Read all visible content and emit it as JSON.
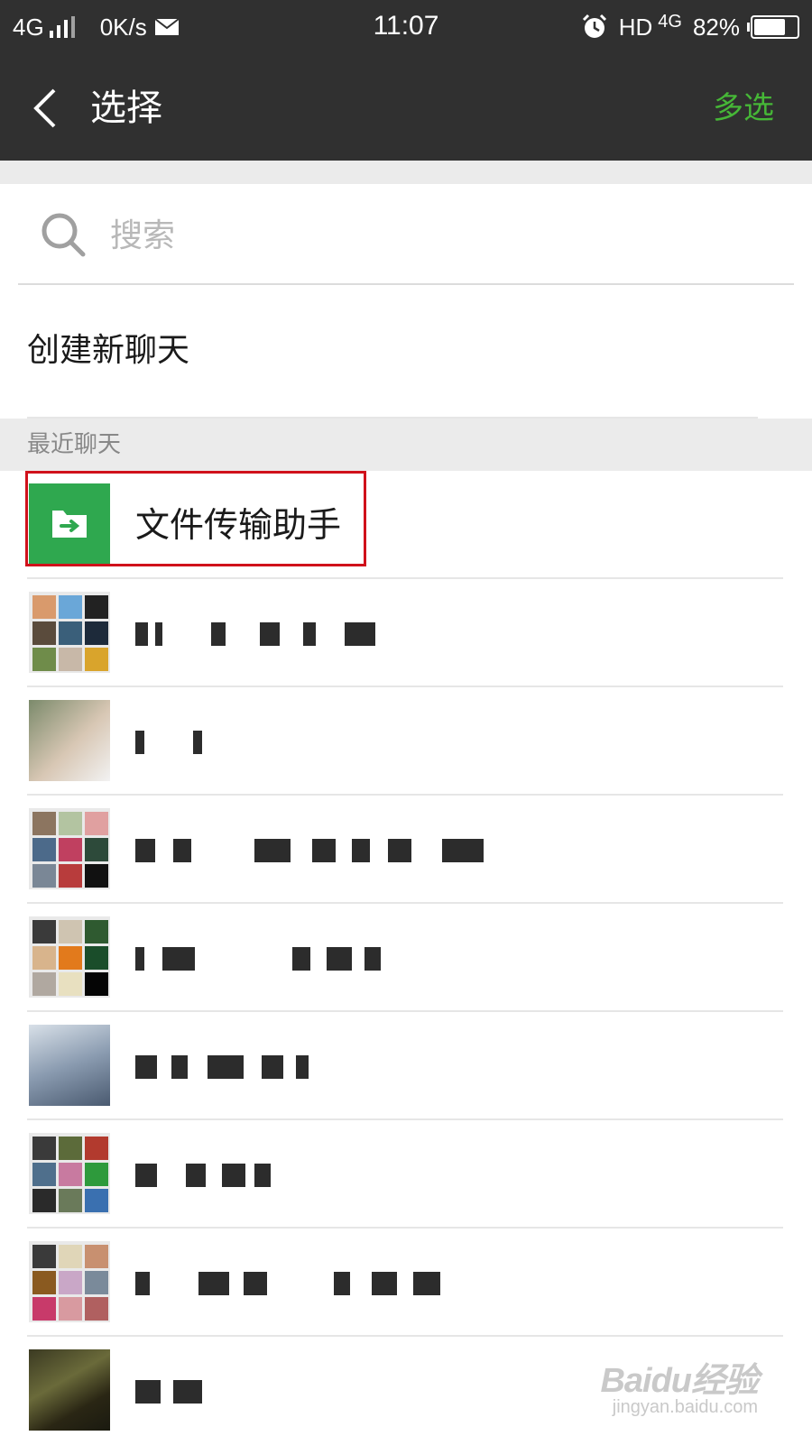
{
  "status_bar": {
    "network": "4G",
    "speed": "0K/s",
    "time": "11:07",
    "hd": "HD",
    "network_right": "4G",
    "battery_text": "82%",
    "battery_level": 0.82
  },
  "nav": {
    "title": "选择",
    "multi_select": "多选",
    "accent_color": "#46b737"
  },
  "search": {
    "placeholder": "搜索"
  },
  "create_chat": {
    "label": "创建新聊天"
  },
  "recent": {
    "header": "最近聊天",
    "items": [
      {
        "name": "文件传输助手",
        "avatar": "file-transfer-icon",
        "highlighted": true
      },
      {
        "name": "",
        "avatar": "group-avatar"
      },
      {
        "name": "",
        "avatar": "photo-avatar"
      },
      {
        "name": "",
        "avatar": "group-avatar"
      },
      {
        "name": "",
        "avatar": "group-avatar"
      },
      {
        "name": "",
        "avatar": "photo-avatar"
      },
      {
        "name": "",
        "avatar": "group-avatar"
      },
      {
        "name": "",
        "avatar": "group-avatar"
      },
      {
        "name": "",
        "avatar": "photo-avatar"
      }
    ]
  },
  "watermark": {
    "logo": "Baidu经验",
    "url": "jingyan.baidu.com"
  },
  "colors": {
    "header_bg": "#303030",
    "highlight": "#d0111b",
    "file_icon_bg": "#2fa84f"
  }
}
